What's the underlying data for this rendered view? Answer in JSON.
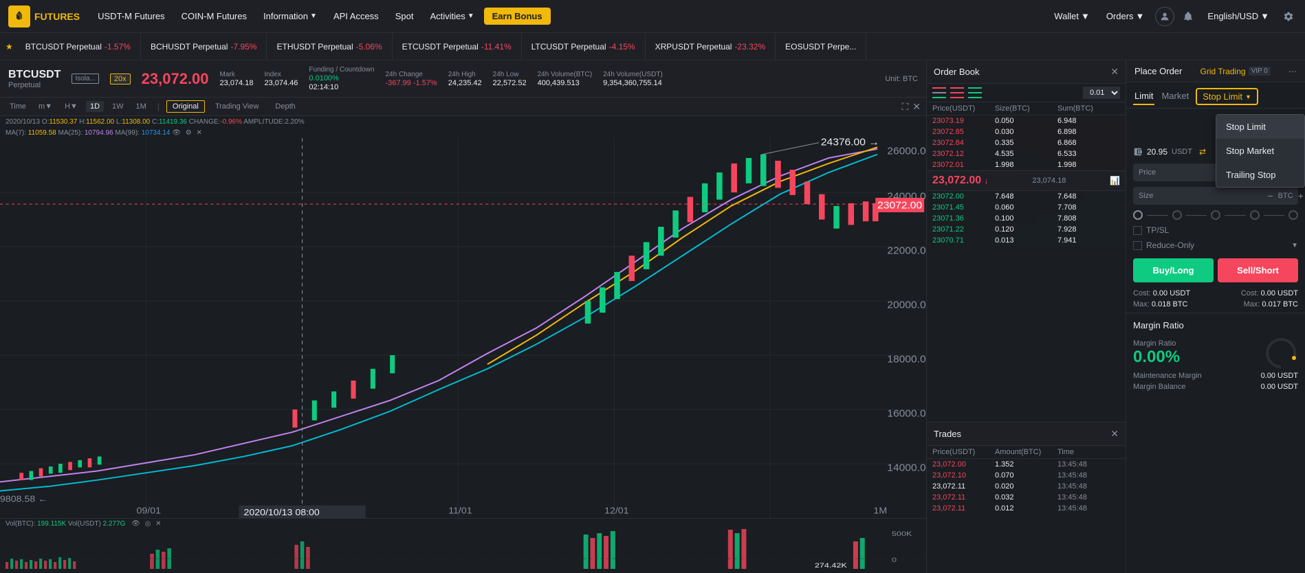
{
  "nav": {
    "logo_text": "FUTURES",
    "items": [
      {
        "label": "USDT-M Futures",
        "has_arrow": false
      },
      {
        "label": "COIN-M Futures",
        "has_arrow": false
      },
      {
        "label": "Information",
        "has_arrow": true
      },
      {
        "label": "API Access",
        "has_arrow": false
      },
      {
        "label": "Spot",
        "has_arrow": false
      },
      {
        "label": "Activities",
        "has_arrow": true
      }
    ],
    "earn_bonus": "Earn Bonus",
    "right": {
      "wallet": "Wallet",
      "orders": "Orders",
      "language": "English/USD"
    }
  },
  "ticker": {
    "items": [
      {
        "name": "BTCUSDT Perpetual",
        "change": "-1.57%",
        "red": true
      },
      {
        "name": "BCHUSDT Perpetual",
        "change": "-7.95%",
        "red": true
      },
      {
        "name": "ETHUSDT Perpetual",
        "change": "-5.06%",
        "red": true
      },
      {
        "name": "ETCUSDT Perpetual",
        "change": "-11.41%",
        "red": true
      },
      {
        "name": "LTCUSDT Perpetual",
        "change": "-4.15%",
        "red": true
      },
      {
        "name": "XRPUSDT Perpetual",
        "change": "-23.32%",
        "red": true
      },
      {
        "name": "EOSUSDT Perpe...",
        "change": "",
        "red": false
      }
    ]
  },
  "symbol": {
    "name": "BTCUSDT",
    "sub": "Perpetual",
    "price": "23,072.00",
    "badge_isolated": "Isola...",
    "badge_leverage": "20x",
    "mark_label": "Mark",
    "mark_val": "23,074.18",
    "index_label": "Index",
    "index_val": "23,074.46",
    "funding_label": "Funding / Countdown",
    "funding_val": "0.0100%",
    "countdown_val": "02:14:10",
    "change_label": "24h Change",
    "change_val": "-367.99",
    "change_pct": "-1.57%",
    "high_label": "24h High",
    "high_val": "24,235.42",
    "low_label": "24h Low",
    "low_val": "22,572.52",
    "vol_btc_label": "24h Volume(BTC)",
    "vol_btc_val": "400,439.513",
    "vol_usdt_label": "24h Volume(USDT)",
    "vol_usdt_val": "9,354,360,755.14",
    "unit": "Unit: BTC"
  },
  "chart_toolbar": {
    "time_tabs": [
      "Time",
      "m▼",
      "H▼",
      "1D",
      "1W",
      "1M"
    ],
    "active_tab": "1D",
    "views": [
      "Original",
      "Trading View",
      "Depth"
    ],
    "active_view": "Original"
  },
  "chart_info": {
    "date": "2020/10/13",
    "open_label": "O:",
    "open_val": "11530.37",
    "high_label": "H:",
    "high_val": "11562.00",
    "low_label": "L:",
    "low_val": "11308.00",
    "close_label": "C:",
    "close_val": "11419.36",
    "change_label": "CHANGE:",
    "change_val": "-0.96%",
    "amplitude_label": "AMPLITUDE:",
    "amplitude_val": "2.20%",
    "ma7_label": "MA(7):",
    "ma7_val": "11059.58",
    "ma25_label": "MA(25):",
    "ma25_val": "10794.96",
    "ma99_label": "MA(99):",
    "ma99_val": "10734.14",
    "price_label": "23072.00",
    "high_price": "24376.00",
    "vol_label": "Vol(BTC):",
    "vol_val": "199.115K",
    "vol_usdt_label": "Vol(USDT)",
    "vol_usdt_val": "2.277G"
  },
  "order_book": {
    "title": "Order Book",
    "decimals": "0.01",
    "headers": [
      "Price(USDT)",
      "Size(BTC)",
      "Sum(BTC)"
    ],
    "asks": [
      {
        "price": "23073.19",
        "size": "0.050",
        "sum": "6.948"
      },
      {
        "price": "23072.85",
        "size": "0.030",
        "sum": "6.898"
      },
      {
        "price": "23072.84",
        "size": "0.335",
        "sum": "6.868"
      },
      {
        "price": "23072.12",
        "size": "4.535",
        "sum": "6.533"
      },
      {
        "price": "23072.01",
        "size": "1.998",
        "sum": "1.998"
      }
    ],
    "mid_price": "23,072.00",
    "mid_arrow": "↓",
    "mid_mark": "23,074.18",
    "bids": [
      {
        "price": "23072.00",
        "size": "7.648",
        "sum": "7.648"
      },
      {
        "price": "23071.45",
        "size": "0.060",
        "sum": "7.708"
      },
      {
        "price": "23071.36",
        "size": "0.100",
        "sum": "7.808"
      },
      {
        "price": "23071.22",
        "size": "0.120",
        "sum": "7.928"
      },
      {
        "price": "23070.71",
        "size": "0.013",
        "sum": "7.941"
      }
    ]
  },
  "trades": {
    "title": "Trades",
    "headers": [
      "Price(USDT)",
      "Amount(BTC)",
      "Time"
    ],
    "rows": [
      {
        "price": "23,072.00",
        "amount": "1.352",
        "time": "13:45:48",
        "red": true
      },
      {
        "price": "23,072.10",
        "amount": "0.070",
        "time": "13:45:48",
        "red": true
      },
      {
        "price": "23,072.11",
        "amount": "0.020",
        "time": "13:45:48",
        "red": false
      },
      {
        "price": "23,072.11",
        "amount": "0.032",
        "time": "13:45:48",
        "red": true
      },
      {
        "price": "23,072.11",
        "amount": "0.012",
        "time": "13:45:48",
        "red": true
      }
    ]
  },
  "place_order": {
    "title": "Place Order",
    "grid_trading": "Grid Trading",
    "vip": "VIP 0",
    "tabs": {
      "limit": "Limit",
      "market": "Market",
      "stop_limit": "Stop Limit"
    },
    "stop_dropdown": {
      "items": [
        "Stop Limit",
        "Stop Market",
        "Trailing Stop"
      ],
      "active": "Stop Limit"
    },
    "wallet_amount": "20.95",
    "wallet_currency": "USDT",
    "price_label": "Price",
    "size_label": "Size",
    "tpsl_label": "TP/SL",
    "reduce_only_label": "Reduce-Only",
    "buy_label": "Buy/Long",
    "sell_label": "Sell/Short",
    "cost_buy_label": "Cost:",
    "cost_buy_val": "0.00 USDT",
    "max_buy_label": "Max:",
    "max_buy_val": "0.018 BTC",
    "cost_sell_label": "Cost:",
    "cost_sell_val": "0.00 USDT",
    "max_sell_label": "Max:",
    "max_sell_val": "0.017 BTC"
  },
  "margin": {
    "title": "Margin Ratio",
    "ratio_label": "Margin Ratio",
    "ratio_val": "0.00%",
    "maintenance_label": "Maintenance Margin",
    "maintenance_val": "0.00 USDT",
    "balance_label": "Margin Balance",
    "balance_val": "0.00 USDT"
  },
  "colors": {
    "red": "#f6465d",
    "green": "#0ecb81",
    "yellow": "#f0b90b",
    "bg_dark": "#1a1d21",
    "bg_medium": "#1e2026",
    "bg_light": "#2b2f36",
    "text_muted": "#848e9c"
  }
}
